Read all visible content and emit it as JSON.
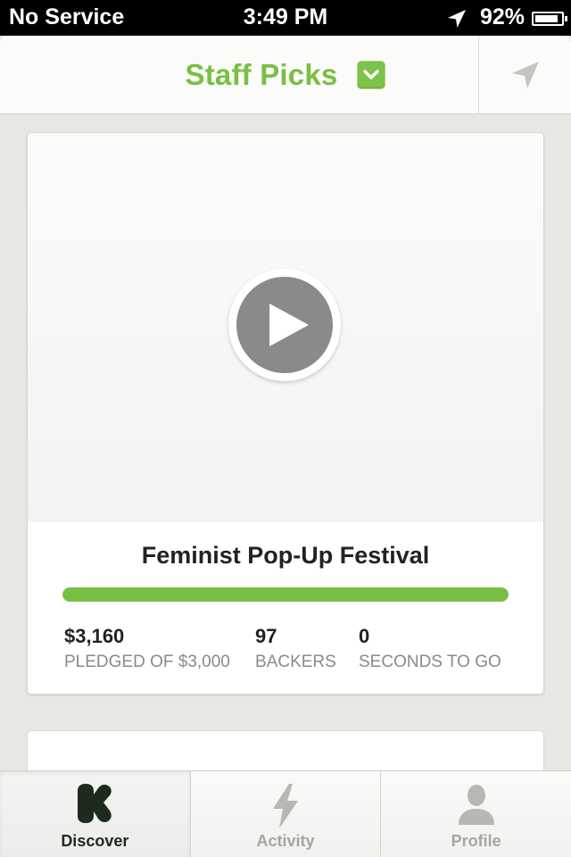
{
  "status_bar": {
    "carrier": "No Service",
    "time": "3:49 PM",
    "battery": "92%",
    "battery_level": 0.92
  },
  "nav": {
    "title": "Staff Picks",
    "dropdown_icon": "chevron-down-icon",
    "location_icon": "location-arrow-icon",
    "accent_color": "#78c044"
  },
  "project": {
    "title": "Feminist Pop-Up Festival",
    "progress": 1.0,
    "stats": [
      {
        "value": "$3,160",
        "label": "PLEDGED OF $3,000"
      },
      {
        "value": "97",
        "label": "BACKERS"
      },
      {
        "value": "0",
        "label": "SECONDS TO GO"
      }
    ],
    "play_icon": "play-icon"
  },
  "tabs": [
    {
      "label": "Discover",
      "icon": "kickstarter-k-icon",
      "active": true
    },
    {
      "label": "Activity",
      "icon": "lightning-icon",
      "active": false
    },
    {
      "label": "Profile",
      "icon": "person-icon",
      "active": false
    }
  ]
}
